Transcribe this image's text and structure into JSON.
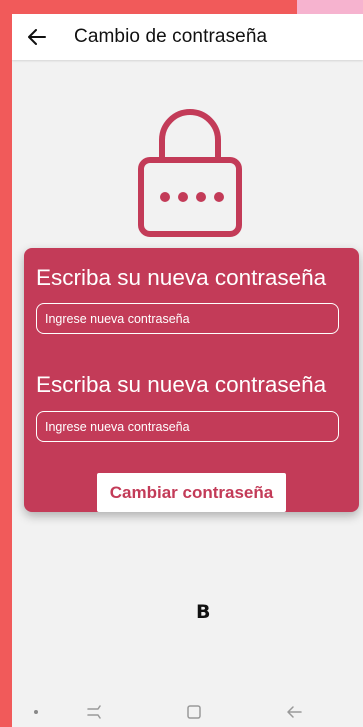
{
  "appbar": {
    "title": "Cambio de contraseña",
    "back_icon": "arrow-left-icon"
  },
  "lock_icon": "lock-icon",
  "form": {
    "heading_new": "Escriba su nueva contraseña",
    "new_password_placeholder": "Ingrese nueva contraseña",
    "heading_confirm": "Escriba su nueva contraseña",
    "confirm_password_placeholder": "Ingrese nueva contraseña",
    "submit_label": "Cambiar contraseña"
  },
  "overlay_mark": "B",
  "navbar": {
    "icons": [
      "dot-icon",
      "recent-apps-icon",
      "home-icon",
      "back-icon"
    ]
  },
  "colors": {
    "card": "#c33b58",
    "lock": "#c33b58",
    "outer_frame": "#f15a5a",
    "corner": "#f6b3cf",
    "screen_bg": "#f2f2f2"
  }
}
